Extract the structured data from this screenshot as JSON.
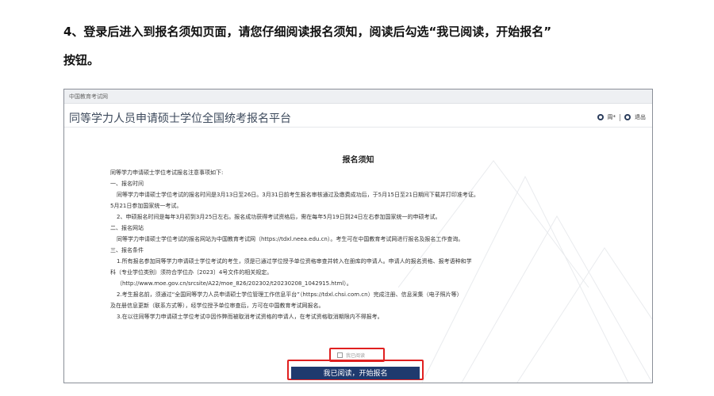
{
  "instruction": {
    "line1": "4、登录后进入到报名须知页面，请您仔细阅读报名须知，阅读后勾选“我已阅读，开始报名”",
    "line2": "按钮。"
  },
  "site": {
    "top_label": "中国教育考试网",
    "platform_title": "同等学力人员申请硕士学位全国统考报名平台",
    "user_name": "周*",
    "logout": "退出"
  },
  "notice": {
    "title": "报名须知",
    "lines": [
      "同等学力申请硕士学位考试报名注意事项如下:",
      "一、报名时间",
      "同等学力申请硕士学位考试的报名时间是3月13日至26日。3月31日前考生报名审核通过及缴费成功后，于5月15日至21日期间下载并打印准考证。",
      "5月21日参加国家统一考试。",
      "2、申硕报名时间是每年3月初到3月25日左右。报名成功获得考试资格后，需在每年5月19日到24日左右参加国家统一的申硕考试。",
      "二、报名网站",
      "同等学力申请硕士学位考试的报名网站为中国教育考试网（https://tdxl.neea.edu.cn）。考生可在中国教育考试网进行报名及报名工作查询。",
      "三、报名条件",
      "1.所有报名参加同等学力申请硕士学位考试的考生，须是已通过学位授予单位资格审查并转入在册库的申请人。申请人的报名资格、报考语种和学",
      "科（专业学位类别）须符合学位办〔2023〕4号文件的相关规定。",
      "（http://www.moe.gov.cn/srcsite/A22/moe_826/202302/t20230208_1042915.html）。",
      "2.考生报名前，须通过“全国同等学力人员申请硕士学位管理工作信息平台”（https://tdxl.chsi.com.cn）完成注册、信息采集（电子照片等）",
      "及在册信息更新（联系方式等），经学位授予单位审查后，方可在中国教育考试网报名。",
      "3.在以往同等学力申请硕士学位考试中因作弊而被取消考试资格的申请人，在考试资格取消期限内不得报考。"
    ]
  },
  "agree": {
    "label": "我已阅读"
  },
  "start_button": {
    "label": "我已阅读，开始报名"
  },
  "colors": {
    "button_bg": "#1f3a6e",
    "highlight": "#e02020"
  }
}
